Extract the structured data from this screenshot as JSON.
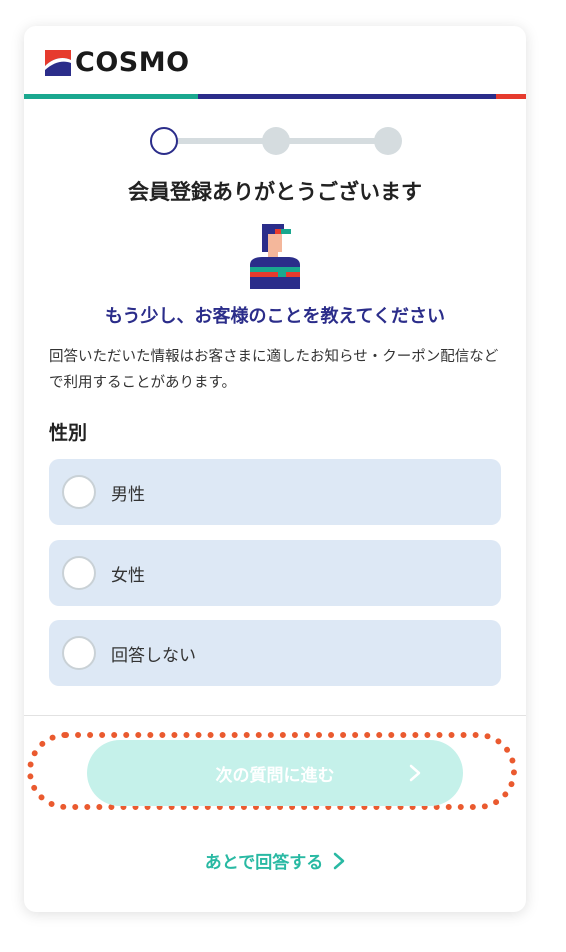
{
  "brand": {
    "name": "COSMO",
    "colors": {
      "green": "#1aa88f",
      "navy": "#2b2d8a",
      "red": "#e63b2e"
    }
  },
  "progress": {
    "total_steps": 3,
    "current_step": 1
  },
  "heading": "会員登録ありがとうございます",
  "illustration": "staff-person-icon",
  "subtitle": "もう少し、お客様のことを教えてください",
  "description": "回答いただいた情報はお客さまに適したお知らせ・クーポン配信などで利用することがあります。",
  "question": {
    "label": "性別",
    "options": [
      {
        "label": "男性",
        "selected": false
      },
      {
        "label": "女性",
        "selected": false
      },
      {
        "label": "回答しない",
        "selected": false
      }
    ]
  },
  "actions": {
    "next_label": "次の質問に進む",
    "next_enabled": false,
    "later_label": "あとで回答する"
  },
  "highlight_color": "#ea5a2f"
}
